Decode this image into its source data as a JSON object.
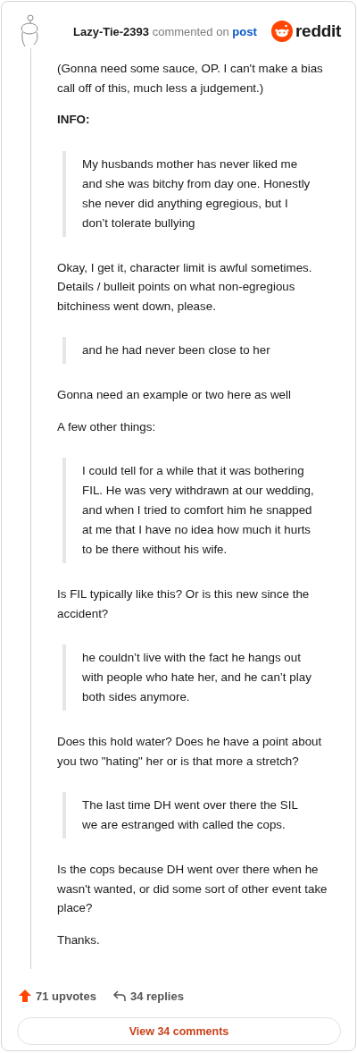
{
  "comment": {
    "author": "Lazy-Tie-2393",
    "action": "commented on",
    "link": "post",
    "brand": "reddit",
    "blocks": [
      {
        "kind": "paragraph",
        "text": "(Gonna need some sauce, OP. I can't make a bias call off of this, much less a judgement.)"
      },
      {
        "kind": "heading",
        "text": "INFO:"
      },
      {
        "kind": "quote",
        "text": "My husbands mother has never liked me and she was bitchy from day one. Honestly she never did anything egregious, but I don’t tolerate bullying"
      },
      {
        "kind": "paragraph",
        "text": "Okay, I get it, character limit is awful sometimes. Details / bulleit points on what non-egregious bitchiness went down, please."
      },
      {
        "kind": "quote",
        "text": "and he had never been close to her"
      },
      {
        "kind": "paragraph",
        "text": "Gonna need an example or two here as well"
      },
      {
        "kind": "paragraph",
        "text": "A few other things:"
      },
      {
        "kind": "quote",
        "text": "I could tell for a while that it was bothering FIL. He was very withdrawn at our wedding, and when I tried to comfort him he snapped at me that I have no idea how much it hurts to be there without his wife."
      },
      {
        "kind": "paragraph",
        "text": "Is FIL typically like this? Or is this new since the accident?"
      },
      {
        "kind": "quote",
        "text": "he couldn’t live with the fact he hangs out with people who hate her, and he can’t play both sides anymore."
      },
      {
        "kind": "paragraph",
        "text": "Does this hold water? Does he have a point about you two \"hating\" her or is that more a stretch?"
      },
      {
        "kind": "quote",
        "text": "The last time DH went over there the SIL we are estranged with called the cops."
      },
      {
        "kind": "paragraph",
        "text": "Is the cops because DH went over there when he wasn't wanted, or did some sort of other event take place?"
      },
      {
        "kind": "paragraph",
        "text": "Thanks."
      }
    ],
    "upvotes": "71 upvotes",
    "replies": "34 replies",
    "view_button": "View 34 comments"
  }
}
